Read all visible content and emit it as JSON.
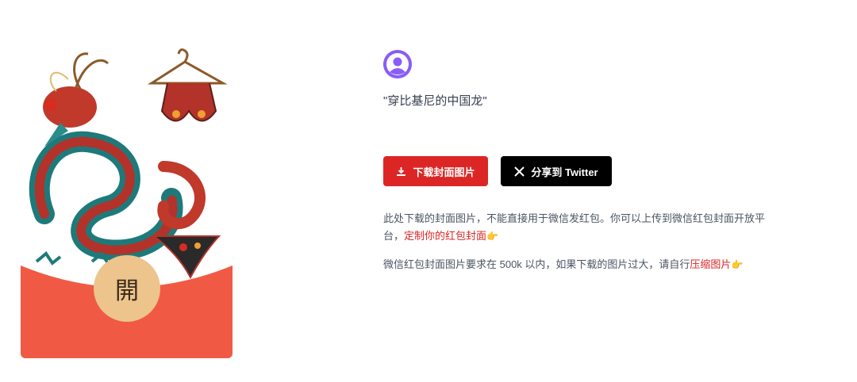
{
  "cover": {
    "open_char": "開",
    "colors": {
      "envelope": "#f05a44",
      "seal": "#ecc48c"
    }
  },
  "profile": {
    "avatar_icon": "user-avatar-icon",
    "accent": "#8b5cf6"
  },
  "title": "\"穿比基尼的中国龙\"",
  "actions": {
    "download_label": "下载封面图片",
    "download_icon": "download-icon",
    "download_color": "#dc2626",
    "twitter_label": "分享到 Twitter",
    "twitter_icon": "x-logo-icon",
    "twitter_color": "#000000"
  },
  "notes": {
    "first_text": "此处下载的封面图片，不能直接用于微信发红包。你可以上传到微信红包封面开放平台，",
    "first_link": "定制你的红包封面",
    "second_text": "微信红包封面图片要求在 500k 以内，如果下载的图片过大，请自行",
    "second_link": "压缩图片",
    "pointer_glyph": "👉"
  }
}
